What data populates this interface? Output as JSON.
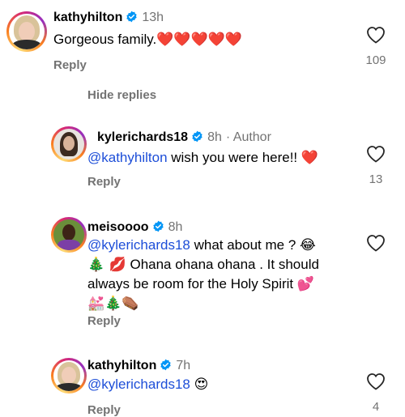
{
  "comments": [
    {
      "username": "kathyhilton",
      "time": "13h",
      "author_tag": "",
      "mention": "",
      "text": "Gorgeous family.",
      "emoji": "❤️❤️❤️❤️❤️",
      "reply_label": "Reply",
      "likes": "109"
    },
    {
      "username": "kylerichards18",
      "time": "8h",
      "author_tag": "· Author",
      "mention": "@kathyhilton",
      "text": " wish you were here!!",
      "emoji": "❤️",
      "reply_label": "Reply",
      "likes": "13"
    },
    {
      "username": "meisoooo",
      "time": "8h",
      "author_tag": "",
      "mention": "@kylerichards18",
      "text_line1": " what about me ?",
      "emoji_line1": "😂",
      "emoji_line2": "🎄 💋",
      "text_line2": " Ohana ohana ohana . It should",
      "text_line3": "always be room for the Holy Spirit",
      "emoji_line3": "💕",
      "emoji_line4": "💒🎄⚰️",
      "reply_label": "Reply",
      "likes": ""
    },
    {
      "username": "kathyhilton",
      "time": "7h",
      "author_tag": "",
      "mention": "@kylerichards18",
      "emoji": "😍",
      "reply_label": "Reply",
      "likes": "4"
    }
  ],
  "hide_replies_label": "Hide replies",
  "icons": {
    "verified": "verified-badge-icon",
    "like": "heart-outline-icon"
  },
  "colors": {
    "mention": "#1d4ed8",
    "secondary_text": "#737373",
    "verified_blue": "#0095f6"
  }
}
